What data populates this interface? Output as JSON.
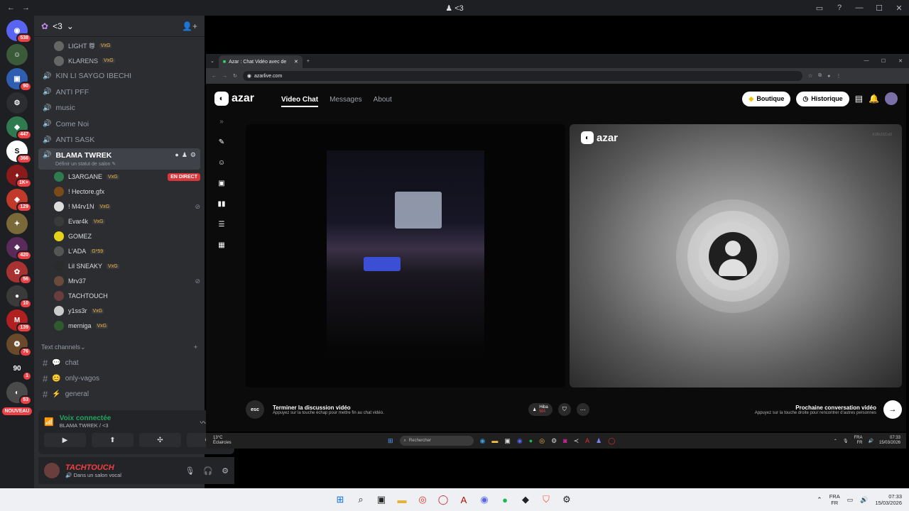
{
  "window": {
    "title": "<3",
    "title_icon": "person-icon"
  },
  "rail": {
    "servers": [
      {
        "badge": "538",
        "color": "#5865f2",
        "glyph": "◉"
      },
      {
        "badge": "",
        "color": "#3a5a3a",
        "glyph": "☺"
      },
      {
        "badge": "90",
        "color": "#2f5db0",
        "glyph": "▣"
      },
      {
        "badge": "",
        "color": "#2b2d31",
        "glyph": "⚙"
      },
      {
        "badge": "447",
        "color": "#2f7a4e",
        "glyph": "◆"
      },
      {
        "badge": "366",
        "color": "#ffffff",
        "glyph": "S"
      },
      {
        "badge": "1K+",
        "color": "#8b1a1a",
        "glyph": "♦"
      },
      {
        "badge": "129",
        "color": "#c0392b",
        "glyph": "◈"
      },
      {
        "badge": "",
        "color": "#7a6a3a",
        "glyph": "✦"
      },
      {
        "badge": "420",
        "color": "#5a2a5a",
        "glyph": "❖"
      },
      {
        "badge": "56",
        "color": "#a83232",
        "glyph": "✿"
      },
      {
        "badge": "10",
        "color": "#3a3a3a",
        "glyph": "●"
      },
      {
        "badge": "139",
        "color": "#b02020",
        "glyph": "M"
      },
      {
        "badge": "76",
        "color": "#6a4a2a",
        "glyph": "❂"
      },
      {
        "badge": "1",
        "color": "#1e1f22",
        "glyph": "90"
      },
      {
        "badge": "53",
        "color": "#4a4a4a",
        "glyph": "◐"
      }
    ],
    "new_label": "NOUVEAU"
  },
  "server": {
    "name": "<3"
  },
  "voice_channels_top": [
    {
      "name": "LIGHT 尊",
      "tag": "VxG"
    },
    {
      "name": "KLARENS",
      "tag": "VxG"
    }
  ],
  "channels": [
    {
      "name": "KIN LI SAYGO IBECHI"
    },
    {
      "name": "ANTI PFF"
    },
    {
      "name": "music"
    },
    {
      "name": "Come Noi"
    },
    {
      "name": "ANTI SASK"
    }
  ],
  "active_channel": {
    "name": "BLAMA TWREK",
    "status": "Définir un statut de salon"
  },
  "members": [
    {
      "name": "L3ARGANE",
      "tag": "VxG",
      "extra": "EN DIRECT",
      "color": "#2f7a4e"
    },
    {
      "name": "! Hectore.gfx",
      "tag": "",
      "extra": "",
      "color": "#7a4a1a"
    },
    {
      "name": "! M4rv1N",
      "tag": "VxG",
      "extra": "muted",
      "color": "#dddddd"
    },
    {
      "name": "Evar4k",
      "tag": "VxG",
      "extra": "",
      "color": "#3a3a3a"
    },
    {
      "name": "GOMEZ",
      "tag": "",
      "extra": "",
      "color": "#e6d21a"
    },
    {
      "name": "L'ADA",
      "tag": "G*59",
      "extra": "",
      "color": "#555555"
    },
    {
      "name": "Lil SNEAKY",
      "tag": "VxG",
      "extra": "",
      "color": "#2b2b2b"
    },
    {
      "name": "Mrv37",
      "tag": "",
      "extra": "muted",
      "color": "#6a4a3a"
    },
    {
      "name": "TACHTOUCH",
      "tag": "",
      "extra": "",
      "color": "#6b3e3e"
    },
    {
      "name": "y1ss3r",
      "tag": "VxG",
      "extra": "",
      "color": "#cccccc"
    },
    {
      "name": "merniga",
      "tag": "VxG",
      "extra": "",
      "color": "#2f5a2f"
    }
  ],
  "text_category": "Text channels",
  "text_channels": [
    {
      "name": "chat",
      "emoji": "💬"
    },
    {
      "name": "only-vagos",
      "emoji": "😊"
    },
    {
      "name": "general",
      "emoji": "⚡"
    }
  ],
  "voice_panel": {
    "title": "Voix connectée",
    "sub": "BLAMA TWREK / <3"
  },
  "user": {
    "name": "TACHTOUCH",
    "status": "Dans un salon vocal"
  },
  "browser": {
    "tab_title": "Azar : Chat Vidéo avec de",
    "url": "azarlive.com"
  },
  "azar": {
    "logo": "azar",
    "nav": [
      "Video Chat",
      "Messages",
      "About"
    ],
    "boutique": "Boutique",
    "historique": "Historique",
    "right_logo": "azar",
    "peer_id": "KJ8s1SCxt3",
    "end_title": "Terminer la discussion vidéo",
    "end_sub": "Appuyez sur la touche échap pour mettre fin au chat vidéo.",
    "esc": "esc",
    "chip_name": "Hiba",
    "chip_country": "MA",
    "next_title": "Prochaine conversation vidéo",
    "next_sub": "Appuyez sur la touche droite pour rencontrer d'autres personnes"
  },
  "inner_taskbar": {
    "temp": "13°C",
    "weather": "Éclaircies",
    "search": "Rechercher",
    "lang1": "FRA",
    "lang2": "FR",
    "time": "07:33",
    "date": "15/03/2026"
  },
  "taskbar": {
    "lang1": "FRA",
    "lang2": "FR",
    "time": "07:33",
    "date": "15/03/2026"
  }
}
